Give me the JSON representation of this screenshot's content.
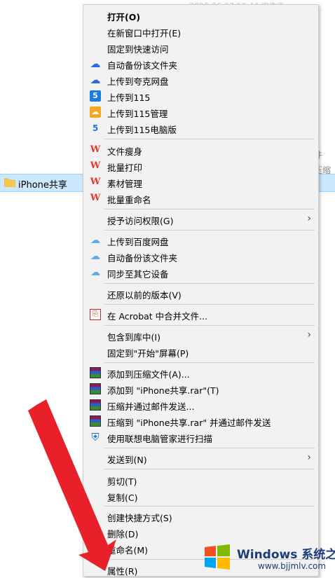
{
  "background": {
    "top_text": "2020-06-07 13:44  文件夹",
    "right_text_1": "件",
    "right_text_2": "压缩",
    "selected_file": "iPhone共享"
  },
  "menu": {
    "items": [
      {
        "label": "打开(O)",
        "icon": "none",
        "bold": true
      },
      {
        "label": "在新窗口中打开(E)",
        "icon": "none"
      },
      {
        "label": "固定到快速访问",
        "icon": "none"
      },
      {
        "label": "自动备份该文件夹",
        "icon": "cloud-icon"
      },
      {
        "label": "上传到夸克网盘",
        "icon": "cloud-icon"
      },
      {
        "label": "上传到115",
        "icon": "115-icon"
      },
      {
        "label": "上传到115管理",
        "icon": "115-manage-icon"
      },
      {
        "label": "上传到115电脑版",
        "icon": "115-pc-icon"
      },
      {
        "label": "文件瘦身",
        "icon": "wps-icon"
      },
      {
        "label": "批量打印",
        "icon": "wps-icon"
      },
      {
        "label": "素材管理",
        "icon": "wps-icon"
      },
      {
        "label": "批量重命名",
        "icon": "wps-icon"
      },
      {
        "label": "授予访问权限(G)",
        "icon": "none",
        "submenu": true
      },
      {
        "label": "上传到百度网盘",
        "icon": "baidu-icon"
      },
      {
        "label": "自动备份该文件夹",
        "icon": "baidu-icon"
      },
      {
        "label": "同步至其它设备",
        "icon": "baidu-icon"
      },
      {
        "label": "还原以前的版本(V)",
        "icon": "none"
      },
      {
        "label": "在 Acrobat 中合并文件...",
        "icon": "acrobat-icon"
      },
      {
        "label": "包含到库中(I)",
        "icon": "none",
        "submenu": true
      },
      {
        "label": "固定到\"开始\"屏幕(P)",
        "icon": "none"
      },
      {
        "label": "添加到压缩文件(A)...",
        "icon": "winrar-icon"
      },
      {
        "label": "添加到 \"iPhone共享.rar\"(T)",
        "icon": "winrar-icon"
      },
      {
        "label": "压缩并通过邮件发送...",
        "icon": "winrar-icon"
      },
      {
        "label": "压缩到 \"iPhone共享.rar\" 并通过邮件发送",
        "icon": "winrar-icon"
      },
      {
        "label": "使用联想电脑管家进行扫描",
        "icon": "lenovo-shield-icon"
      },
      {
        "label": "发送到(N)",
        "icon": "none",
        "submenu": true
      },
      {
        "label": "剪切(T)",
        "icon": "none"
      },
      {
        "label": "复制(C)",
        "icon": "none"
      },
      {
        "label": "创建快捷方式(S)",
        "icon": "none"
      },
      {
        "label": "删除(D)",
        "icon": "none"
      },
      {
        "label": "重命名(M)",
        "icon": "none"
      },
      {
        "label": "属性(R)",
        "icon": "none"
      }
    ],
    "submenu_arrow": "›"
  },
  "watermark": {
    "brand": "Windows 系统之家",
    "url": "www.bjjmlv.com"
  },
  "colors": {
    "menu_bg": "#f2f2f2",
    "selection": "#cce8ff",
    "arrow": "#e8202a"
  }
}
